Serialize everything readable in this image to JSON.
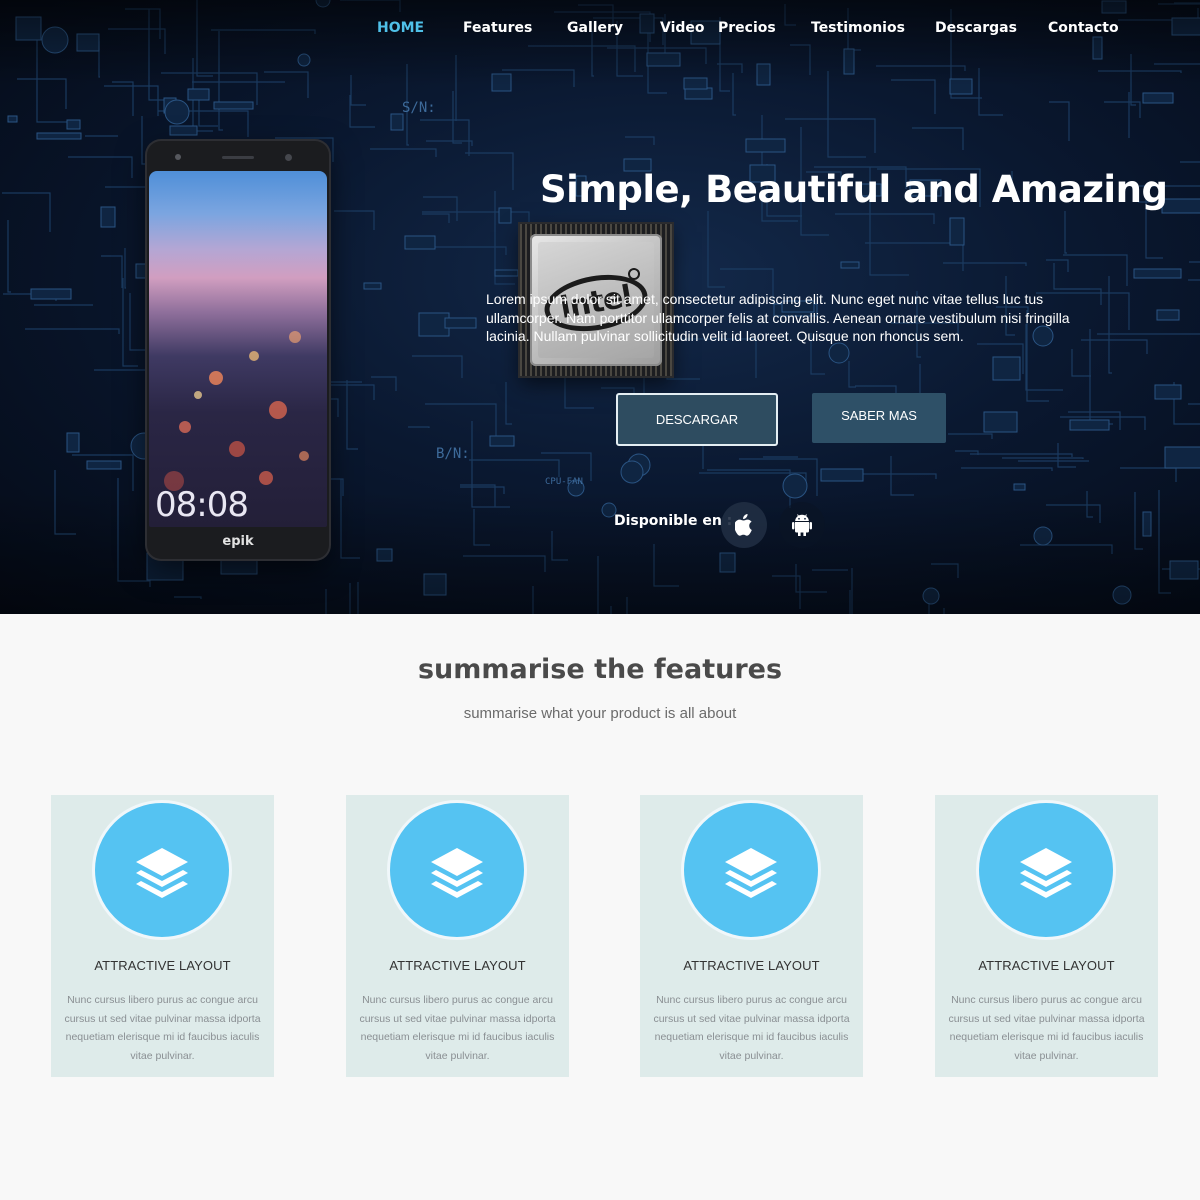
{
  "nav": {
    "items": [
      {
        "label": "HOME",
        "active": true
      },
      {
        "label": "Features"
      },
      {
        "label": "Gallery"
      },
      {
        "label": "Video"
      },
      {
        "label": "Precios"
      },
      {
        "label": "Testimonios"
      },
      {
        "label": "Descargas"
      },
      {
        "label": "Contacto"
      }
    ]
  },
  "hero": {
    "title": "Simple, Beautiful and Amazing",
    "description": "Lorem ipsum dolor sit amet, consectetur adipiscing elit. Nunc eget nunc vitae tellus luc tus ullamcorper. Nam porttitor ullamcorper felis at convallis. Aenean ornare vestibulum nisi fringilla lacinia. Nullam pulvinar sollicitudin velit id laoreet. Quisque non rhoncus sem.",
    "download_label": "DESCARGAR",
    "more_label": "SABER MAS",
    "available_label": "Disponible en :",
    "phone": {
      "time": "08:08",
      "brand": "epik"
    },
    "chip": {
      "logo_text": "intel"
    }
  },
  "features": {
    "title": "summarise the features",
    "subtitle": "summarise what your product is all about",
    "cards": [
      {
        "title": "ATTRACTIVE LAYOUT",
        "text": "Nunc cursus libero purus ac congue arcu cursus ut sed vitae pulvinar massa idporta nequetiam elerisque mi id faucibus iaculis vitae pulvinar.",
        "icon": "layers-icon"
      },
      {
        "title": "ATTRACTIVE LAYOUT",
        "text": "Nunc cursus libero purus ac congue arcu cursus ut sed vitae pulvinar massa idporta nequetiam elerisque mi id faucibus iaculis vitae pulvinar.",
        "icon": "layers-icon"
      },
      {
        "title": "ATTRACTIVE LAYOUT",
        "text": "Nunc cursus libero purus ac congue arcu cursus ut sed vitae pulvinar massa idporta nequetiam elerisque mi id faucibus iaculis vitae pulvinar.",
        "icon": "layers-icon"
      },
      {
        "title": "ATTRACTIVE LAYOUT",
        "text": "Nunc cursus libero purus ac congue arcu cursus ut sed vitae pulvinar massa idporta nequetiam elerisque mi id faucibus iaculis vitae pulvinar.",
        "icon": "layers-icon"
      }
    ]
  },
  "colors": {
    "accent": "#4fc0e8",
    "button": "#2e4c60",
    "icon_circle": "#55c3f2",
    "card_bg": "#deebea"
  }
}
